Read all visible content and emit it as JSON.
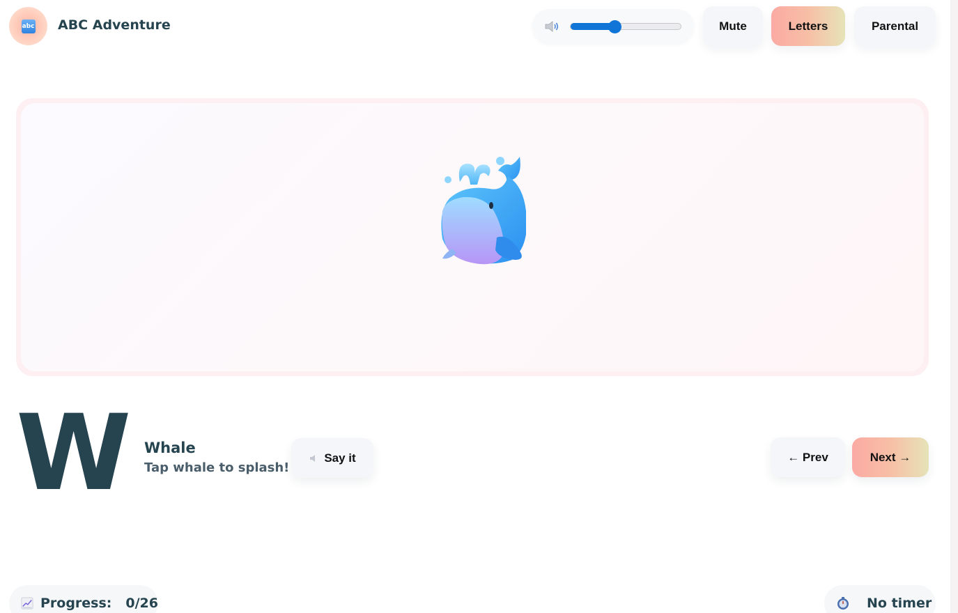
{
  "header": {
    "title": "ABC Adventure",
    "logo_icon": "abc-icon",
    "logo_text": "abc",
    "volume": {
      "value": 0.4
    },
    "buttons": {
      "mute": "Mute",
      "letters": "Letters",
      "parental": "Parental"
    }
  },
  "stage": {
    "emoji": "whale-icon"
  },
  "letter": {
    "char": "W",
    "word": "Whale",
    "hint": "Tap whale to splash!"
  },
  "controls": {
    "say": "Say it",
    "prev": "← Prev",
    "next": "Next →"
  },
  "footer": {
    "progress_label": "Progress:",
    "progress_value": "0/26",
    "timer_label": "No timer"
  },
  "colors": {
    "accent_blue": "#1175d8",
    "text_dark": "#26444f",
    "gradient_start": "#fbaaa3",
    "gradient_end": "#e6e3b8"
  }
}
